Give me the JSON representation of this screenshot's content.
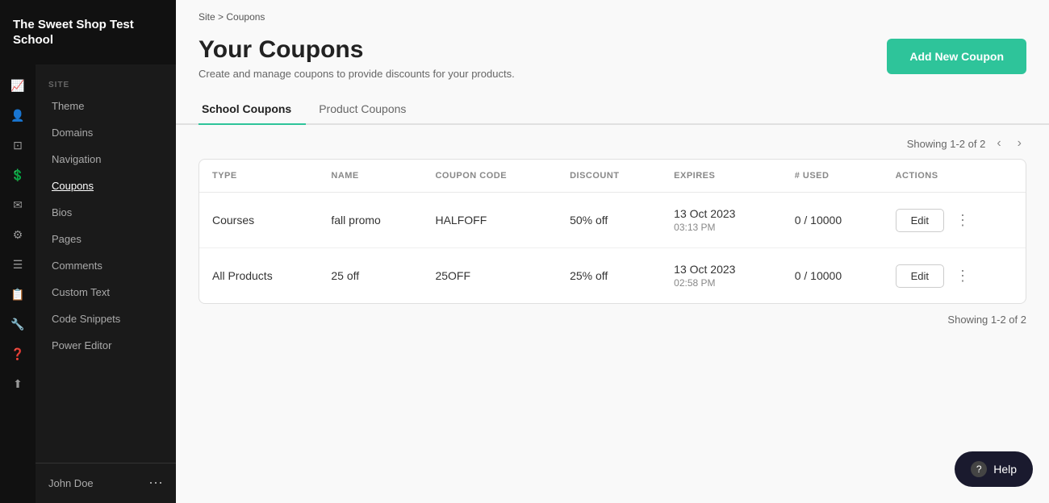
{
  "sidebar": {
    "logo": "The Sweet Shop Test School",
    "section_site": "SITE",
    "icons": [
      {
        "id": "analytics",
        "symbol": "📈"
      },
      {
        "id": "users",
        "symbol": "👤"
      },
      {
        "id": "layout",
        "symbol": "⊡"
      },
      {
        "id": "money",
        "symbol": "💲"
      },
      {
        "id": "mail",
        "symbol": "✉"
      },
      {
        "id": "settings",
        "symbol": "⚙"
      },
      {
        "id": "pages-icon",
        "symbol": "≡"
      },
      {
        "id": "calendar",
        "symbol": "📋"
      },
      {
        "id": "tools",
        "symbol": "🔧"
      },
      {
        "id": "help",
        "symbol": "?"
      },
      {
        "id": "share",
        "symbol": "⬆"
      }
    ],
    "nav_items": [
      {
        "id": "theme",
        "label": "Theme",
        "active": false
      },
      {
        "id": "domains",
        "label": "Domains",
        "active": false
      },
      {
        "id": "navigation",
        "label": "Navigation",
        "active": false
      },
      {
        "id": "coupons",
        "label": "Coupons",
        "active": true
      },
      {
        "id": "bios",
        "label": "Bios",
        "active": false
      },
      {
        "id": "pages",
        "label": "Pages",
        "active": false
      },
      {
        "id": "comments",
        "label": "Comments",
        "active": false
      },
      {
        "id": "custom-text",
        "label": "Custom Text",
        "active": false
      },
      {
        "id": "code-snippets",
        "label": "Code Snippets",
        "active": false
      },
      {
        "id": "power-editor",
        "label": "Power Editor",
        "active": false
      }
    ],
    "user": "John Doe"
  },
  "breadcrumb": {
    "site": "Site",
    "separator": ">",
    "current": "Coupons"
  },
  "page": {
    "title": "Your Coupons",
    "subtitle": "Create and manage coupons to provide discounts for your products.",
    "add_button": "Add New Coupon"
  },
  "tabs": [
    {
      "id": "school-coupons",
      "label": "School Coupons",
      "active": true
    },
    {
      "id": "product-coupons",
      "label": "Product Coupons",
      "active": false
    }
  ],
  "pagination": {
    "showing": "Showing 1-2 of 2"
  },
  "table": {
    "columns": [
      {
        "id": "type",
        "label": "TYPE"
      },
      {
        "id": "name",
        "label": "NAME"
      },
      {
        "id": "coupon_code",
        "label": "COUPON CODE"
      },
      {
        "id": "discount",
        "label": "DISCOUNT"
      },
      {
        "id": "expires",
        "label": "EXPIRES"
      },
      {
        "id": "used",
        "label": "# USED"
      },
      {
        "id": "actions",
        "label": "ACTIONS"
      }
    ],
    "rows": [
      {
        "id": "row1",
        "type": "Courses",
        "name": "fall promo",
        "coupon_code": "HALFOFF",
        "discount": "50% off",
        "expires": "13 Oct 2023\n03:13 PM",
        "expires_line1": "13 Oct 2023",
        "expires_line2": "03:13 PM",
        "used": "0 / 10000",
        "edit_label": "Edit"
      },
      {
        "id": "row2",
        "type": "All Products",
        "name": "25 off",
        "coupon_code": "25OFF",
        "discount": "25% off",
        "expires": "13 Oct 2023\n02:58 PM",
        "expires_line1": "13 Oct 2023",
        "expires_line2": "02:58 PM",
        "used": "0 / 10000",
        "edit_label": "Edit"
      }
    ]
  },
  "help": {
    "label": "Help",
    "icon": "?"
  }
}
